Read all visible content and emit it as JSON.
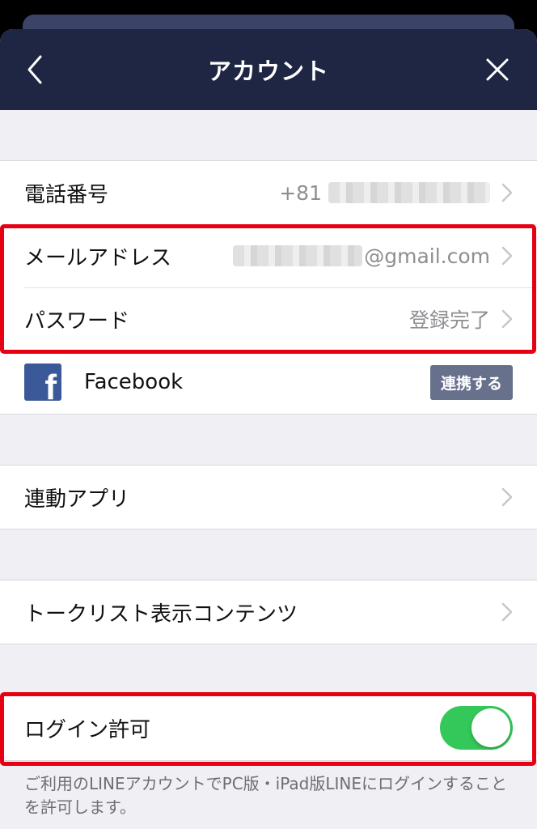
{
  "header": {
    "title": "アカウント"
  },
  "account": {
    "phone": {
      "label": "電話番号",
      "value_prefix": "+81"
    },
    "email": {
      "label": "メールアドレス",
      "value_suffix": "@gmail.com"
    },
    "password": {
      "label": "パスワード",
      "value": "登録完了"
    },
    "facebook": {
      "label": "Facebook",
      "button": "連携する",
      "icon_glyph": "f"
    }
  },
  "apps": {
    "label": "連動アプリ"
  },
  "talklist": {
    "label": "トークリスト表示コンテンツ"
  },
  "login": {
    "label": "ログイン許可",
    "enabled": true,
    "note": "ご利用のLINEアカウントでPC版・iPad版LINEにログインすることを許可します。"
  },
  "colors": {
    "navbar": "#1e2644",
    "highlight": "#e60012",
    "toggle_on": "#34c759",
    "facebook": "#3b5998"
  },
  "icons": [
    "back-chevron-icon",
    "close-icon",
    "chevron-right-icon",
    "facebook-icon"
  ]
}
